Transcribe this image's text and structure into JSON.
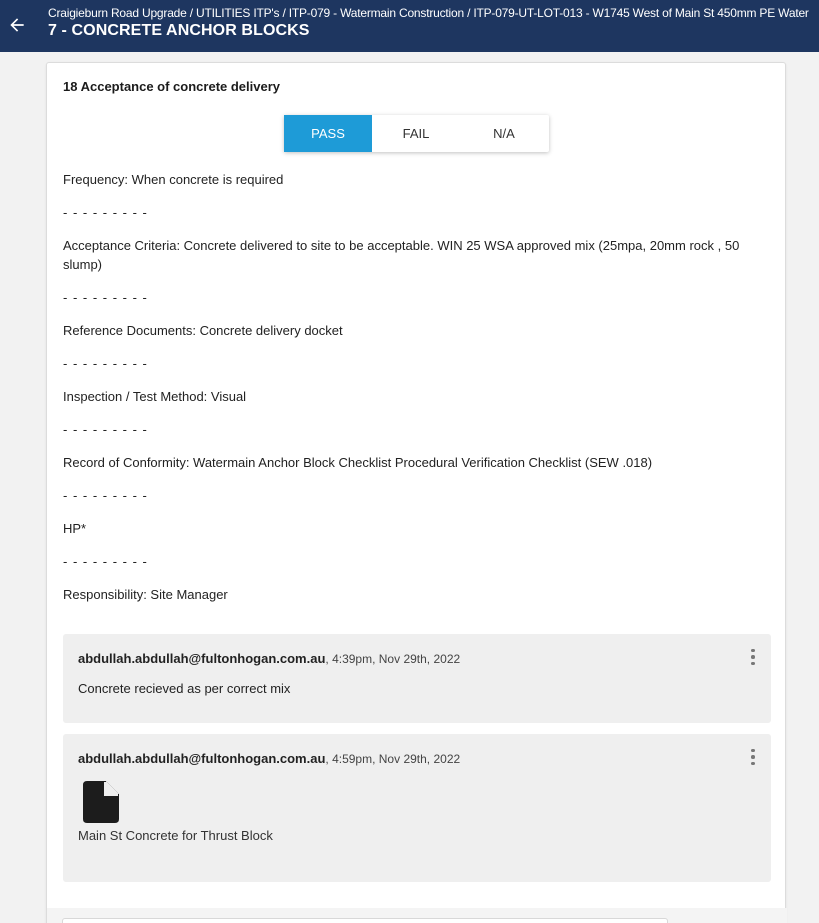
{
  "header": {
    "breadcrumb": "Craigieburn Road Upgrade / UTILITIES ITP's / ITP-079 - Watermain Construction / ITP-079-UT-LOT-013 - W1745 West of Main St 450mm PE Water",
    "title": "7 - CONCRETE ANCHOR BLOCKS",
    "back_icon": "arrow-left-icon"
  },
  "item": {
    "title": "18 Acceptance of concrete delivery",
    "options": [
      "PASS",
      "FAIL",
      "N/A"
    ],
    "selected": "PASS",
    "accent_color": "#1e9bd7"
  },
  "details": {
    "frequency": "Frequency: When concrete is required",
    "separator": "- - - - - - - - -",
    "acceptance": "Acceptance Criteria: Concrete delivered to site to be acceptable. WIN 25 WSA approved mix (25mpa, 20mm rock , 50 slump)",
    "reference": "Reference Documents: Concrete delivery docket",
    "inspection": "Inspection / Test Method: Visual",
    "record": "Record of Conformity: Watermain Anchor Block Checklist Procedural Verification Checklist (SEW .018)",
    "hold_point": "HP*",
    "responsibility": "Responsibility: Site Manager"
  },
  "comments": [
    {
      "author": "abdullah.abdullah@fultonhogan.com.au",
      "timestamp": ", 4:39pm, Nov 29th, 2022",
      "text": "Concrete recieved as per correct mix"
    },
    {
      "author": "abdullah.abdullah@fultonhogan.com.au",
      "timestamp": ", 4:59pm, Nov 29th, 2022",
      "attachment": "Main St Concrete for Thrust Block",
      "attachment_icon": "file-icon"
    }
  ],
  "colors": {
    "header_bg": "#1e3660",
    "accent": "#1e9bd7"
  }
}
